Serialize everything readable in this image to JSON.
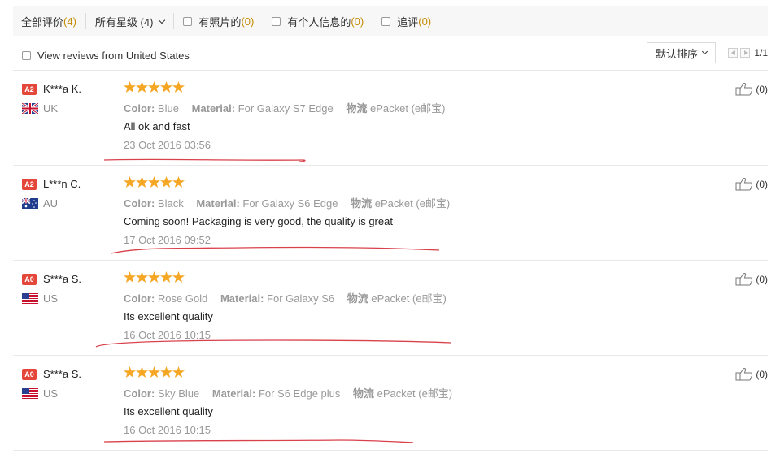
{
  "filters": {
    "all_label": "全部评价",
    "all_count": "(4)",
    "stars_label": "所有星级 (4)",
    "photos_label": "有照片的",
    "photos_count": "(0)",
    "personal_label": "有个人信息的",
    "personal_count": "(0)",
    "additional_label": "追评",
    "additional_count": "(0)"
  },
  "country_filter_label": "View reviews from United States",
  "sort_label": "默认排序",
  "pager_text": "1/1",
  "reviews": [
    {
      "level": "A2",
      "name": "K***a K.",
      "country": "UK",
      "flag_icon": "uk-flag-icon",
      "rating": 5,
      "color_label": "Color:",
      "color": "Blue",
      "material_label": "Material:",
      "material": "For Galaxy S7 Edge",
      "shipping_label": "物流",
      "shipping": "ePacket (e邮宝)",
      "text": "All ok and fast",
      "date": "23 Oct 2016 03:56",
      "likes": "(0)"
    },
    {
      "level": "A2",
      "name": "L***n C.",
      "country": "AU",
      "flag_icon": "au-flag-icon",
      "rating": 5,
      "color_label": "Color:",
      "color": "Black",
      "material_label": "Material:",
      "material": "For Galaxy S6 Edge",
      "shipping_label": "物流",
      "shipping": "ePacket (e邮宝)",
      "text": "Coming soon! Packaging is very good, the quality is great",
      "date": "17 Oct 2016 09:52",
      "likes": "(0)"
    },
    {
      "level": "A0",
      "name": "S***a S.",
      "country": "US",
      "flag_icon": "us-flag-icon",
      "rating": 5,
      "color_label": "Color:",
      "color": "Rose Gold",
      "material_label": "Material:",
      "material": "For Galaxy S6",
      "shipping_label": "物流",
      "shipping": "ePacket (e邮宝)",
      "text": "Its excellent quality",
      "date": "16 Oct 2016 10:15",
      "likes": "(0)"
    },
    {
      "level": "A0",
      "name": "S***a S.",
      "country": "US",
      "flag_icon": "us-flag-icon",
      "rating": 5,
      "color_label": "Color:",
      "color": "Sky Blue",
      "material_label": "Material:",
      "material": "For S6 Edge plus",
      "shipping_label": "物流",
      "shipping": "ePacket (e邮宝)",
      "text": "Its excellent quality",
      "date": "16 Oct 2016 10:15",
      "likes": "(0)"
    }
  ],
  "colors": {
    "count": "#c58a00",
    "badge": "#e4473a",
    "star": "#f5a623",
    "ink": "#d9414b"
  }
}
